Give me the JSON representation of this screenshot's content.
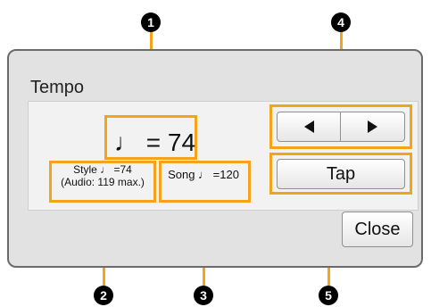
{
  "dialog": {
    "title": "Tempo",
    "tempo_display": "♩ = 74",
    "style_line1": "Style ♩ =74",
    "style_line2": "(Audio: 119 max.)",
    "song_tempo": "Song ♩ =120",
    "left_arrow_icon": "left-triangle",
    "right_arrow_icon": "right-triangle",
    "tap_label": "Tap",
    "close_label": "Close"
  },
  "callouts": [
    "1",
    "2",
    "3",
    "4",
    "5"
  ],
  "colors": {
    "highlight": "#f4a31b",
    "badge": "#000000",
    "dialog_bg": "#e2e2e2"
  }
}
